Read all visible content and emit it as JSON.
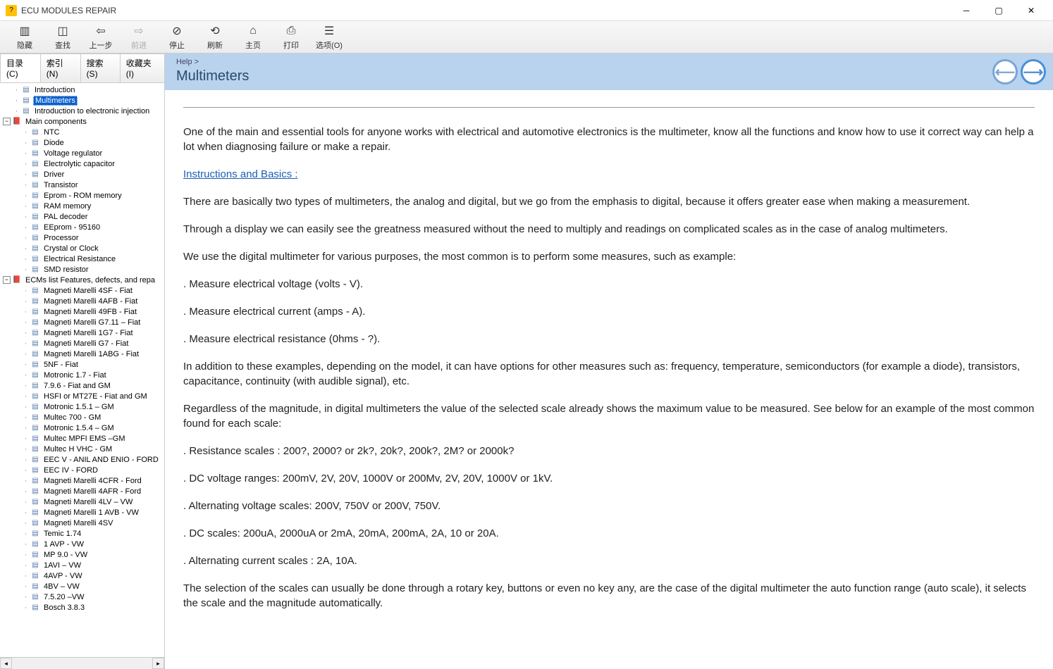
{
  "window": {
    "title": "ECU MODULES REPAIR"
  },
  "toolbar": {
    "hide": "隐藏",
    "find": "查找",
    "back": "上一步",
    "forward": "前进",
    "stop": "停止",
    "refresh": "刷新",
    "home": "主页",
    "print": "打印",
    "options": "选项(O)"
  },
  "tabs": {
    "contents": "目录(C)",
    "index": "索引(N)",
    "search": "搜索(S)",
    "favorites": "收藏夹(I)"
  },
  "tree": {
    "top": [
      "Introduction",
      "Multimeters",
      "Introduction to electronic injection"
    ],
    "selected": "Multimeters",
    "group1": {
      "title": "Main components",
      "items": [
        "NTC",
        "Diode",
        "Voltage regulator",
        "Electrolytic capacitor",
        "Driver",
        "Transistor",
        "Eprom - ROM memory",
        "RAM memory",
        "PAL decoder",
        "EEprom - 95160",
        "Processor",
        "Crystal or Clock",
        "Electrical Resistance",
        "SMD resistor"
      ]
    },
    "group2": {
      "title": "ECMs list Features, defects, and repa",
      "items": [
        "Magneti Marelli 4SF - Fiat",
        "Magneti Marelli 4AFB - Fiat",
        "Magneti Marelli 49FB - Fiat",
        "Magneti Marelli G7.11 – Fiat",
        "Magneti Marelli 1G7 - Fiat",
        "Magneti Marelli G7 - Fiat",
        "Magneti Marelli 1ABG - Fiat",
        "5NF - Fiat",
        "Motronic 1.7 - Fiat",
        "7.9.6 - Fiat and GM",
        "HSFI or MT27E - Fiat and GM",
        "Motronic 1.5.1 – GM",
        "Multec 700 - GM",
        "Motronic 1.5.4 – GM",
        "Multec MPFI EMS –GM",
        "Multec H VHC - GM",
        "EEC V - ANIL AND ENIO - FORD",
        "EEC IV - FORD",
        "Magneti Marelli 4CFR - Ford",
        "Magneti Marelli 4AFR - Ford",
        "Magneti Marelli 4LV – VW",
        "Magneti Marelli 1 AVB - VW",
        "Magneti Marelli 4SV",
        "Temic 1.74",
        "1 AVP - VW",
        "MP 9.0 - VW",
        "1AVI – VW",
        "4AVP - VW",
        "4BV – VW",
        "7.5.20 –VW",
        "Bosch 3.8.3"
      ]
    }
  },
  "page": {
    "breadcrumb": "Help >",
    "title": "Multimeters",
    "p1": "One of the main and essential tools for anyone works with electrical and automotive electronics is the multimeter, know all the functions and know how to use it correct way can help a lot when diagnosing failure or make a repair.",
    "subhead": "Instructions and Basics :",
    "p2": "There are basically two types of multimeters, the analog and digital, but we go from the emphasis to digital, because it offers greater ease when making a measurement.",
    "p3": "Through a display we can easily see the greatness measured without the need to multiply and readings on complicated scales as in the case of analog multimeters.",
    "p4": "We use the digital multimeter for various purposes, the most common is to perform some measures, such as example:",
    "b1": ". Measure electrical voltage (volts - V).",
    "b2": ". Measure electrical current (amps - A).",
    "b3": ". Measure electrical resistance (0hms - ?).",
    "p5": "In addition to these examples, depending on the model, it can have options for other measures such as: frequency, temperature, semiconductors (for example a diode), transistors, capacitance, continuity (with audible signal), etc.",
    "p6": "Regardless of the magnitude, in digital multimeters the value of the selected scale already shows the maximum value to be measured. See below for an example of the most common found for each scale:",
    "s1": ". Resistance scales : 200?, 2000? or 2k?, 20k?, 200k?, 2M? or 2000k?",
    "s2": ". DC voltage ranges: 200mV, 2V, 20V, 1000V or 200Mv, 2V, 20V, 1000V or 1kV.",
    "s3": ". Alternating voltage scales: 200V, 750V or 200V, 750V.",
    "s4": ". DC scales: 200uA, 2000uA or 2mA, 20mA, 200mA, 2A, 10 or 20A.",
    "s5": ". Alternating current scales : 2A, 10A.",
    "p7": "The selection of the scales can usually be done through a rotary key, buttons or even no key any, are the case of the digital multimeter the auto function range (auto scale), it selects the scale and the magnitude automatically."
  }
}
